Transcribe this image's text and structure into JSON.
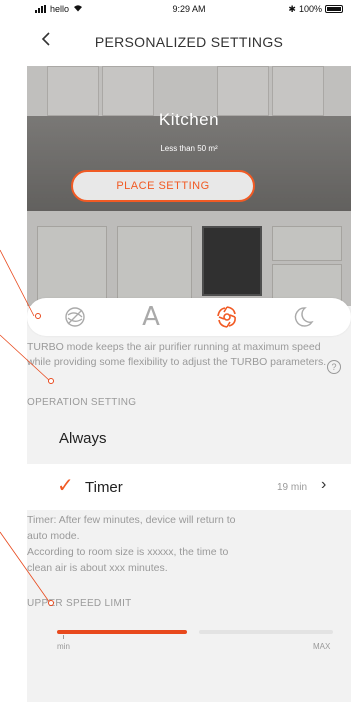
{
  "status_bar": {
    "carrier": "hello",
    "time": "9:29 AM",
    "battery": "100%"
  },
  "header": {
    "back_icon": "chevron-left-icon",
    "title": "PERSONALIZED SETTINGS"
  },
  "room": {
    "name": "Kitchen",
    "size": "Less than 50 m²",
    "place_button": "PLACE SETTING"
  },
  "modes": [
    {
      "icon": "fan-off-icon",
      "selected": false
    },
    {
      "label": "A",
      "icon": "auto-mode-icon",
      "selected": false
    },
    {
      "icon": "turbo-icon",
      "selected": true
    },
    {
      "icon": "sleep-moon-icon",
      "selected": false
    }
  ],
  "turbo_description": "TURBO mode keeps the air purifier running at maximum speed while providing some flexibility to adjust the TURBO parameters.",
  "help_icon": "?",
  "operation_setting": {
    "label": "OPERATION SETTING",
    "options": [
      {
        "label": "Always",
        "selected": false
      },
      {
        "label": "Timer",
        "value": "19 min",
        "selected": true
      }
    ]
  },
  "timer_description_lines": [
    "Timer: After few minutes, device will return to",
    "auto mode.",
    "According to room size is  xxxxx, the time to",
    "clean air is about xxx minutes."
  ],
  "upper_speed_limit": {
    "label": "UPPER SPEED LIMIT",
    "min_label": "min",
    "max_label": "MAX",
    "level_fraction": 0.49
  },
  "colors": {
    "accent": "#f15a24",
    "text_muted": "#9a9a9a",
    "background": "#f2f2f2"
  }
}
